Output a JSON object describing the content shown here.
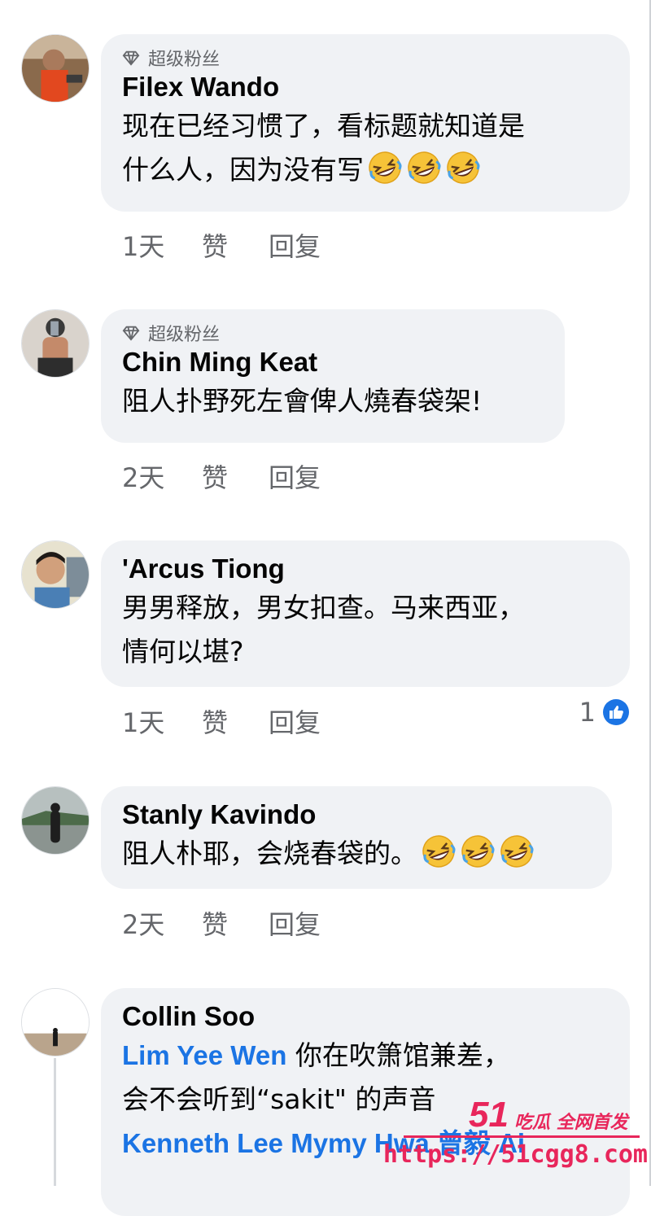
{
  "comments": [
    {
      "badge": "超级粉丝",
      "author": "Filex Wando",
      "text_line1": "现在已经习惯了，看标题就知道是",
      "text_line2": "什么人，因为没有写",
      "emoji_count": 3,
      "time": "1天",
      "like": "赞",
      "reply": "回复"
    },
    {
      "badge": "超级粉丝",
      "author": "Chin Ming Keat",
      "text_line1": "阻人扑野死左會俾人燒春袋架!",
      "time": "2天",
      "like": "赞",
      "reply": "回复"
    },
    {
      "author": "'Arcus Tiong",
      "text_line1": "男男释放，男女扣查。马来西亚，",
      "text_line2": "情何以堪?",
      "time": "1天",
      "like": "赞",
      "reply": "回复",
      "reaction_count": "1"
    },
    {
      "author": "Stanly Kavindo",
      "text_line1": "阻人朴耶，会烧春袋的。",
      "emoji_count": 3,
      "time": "2天",
      "like": "赞",
      "reply": "回复"
    },
    {
      "author": "Collin Soo",
      "mention": "Lim Yee Wen",
      "text_line1_rest": " 你在吹箫馆兼差，",
      "text_line2": "会不会听到“sakit\" 的声音",
      "mention2_partial": "Kenneth Lee Mymy Hwa 曾毅 Ai"
    }
  ],
  "watermark": {
    "logo": "51",
    "tagline": "吃瓜 全网首发",
    "url": "https://51cgg8.com"
  },
  "colors": {
    "bubble": "#f0f2f5",
    "meta": "#65676b",
    "mention": "#1b74e4",
    "watermark": "#e8265b"
  }
}
